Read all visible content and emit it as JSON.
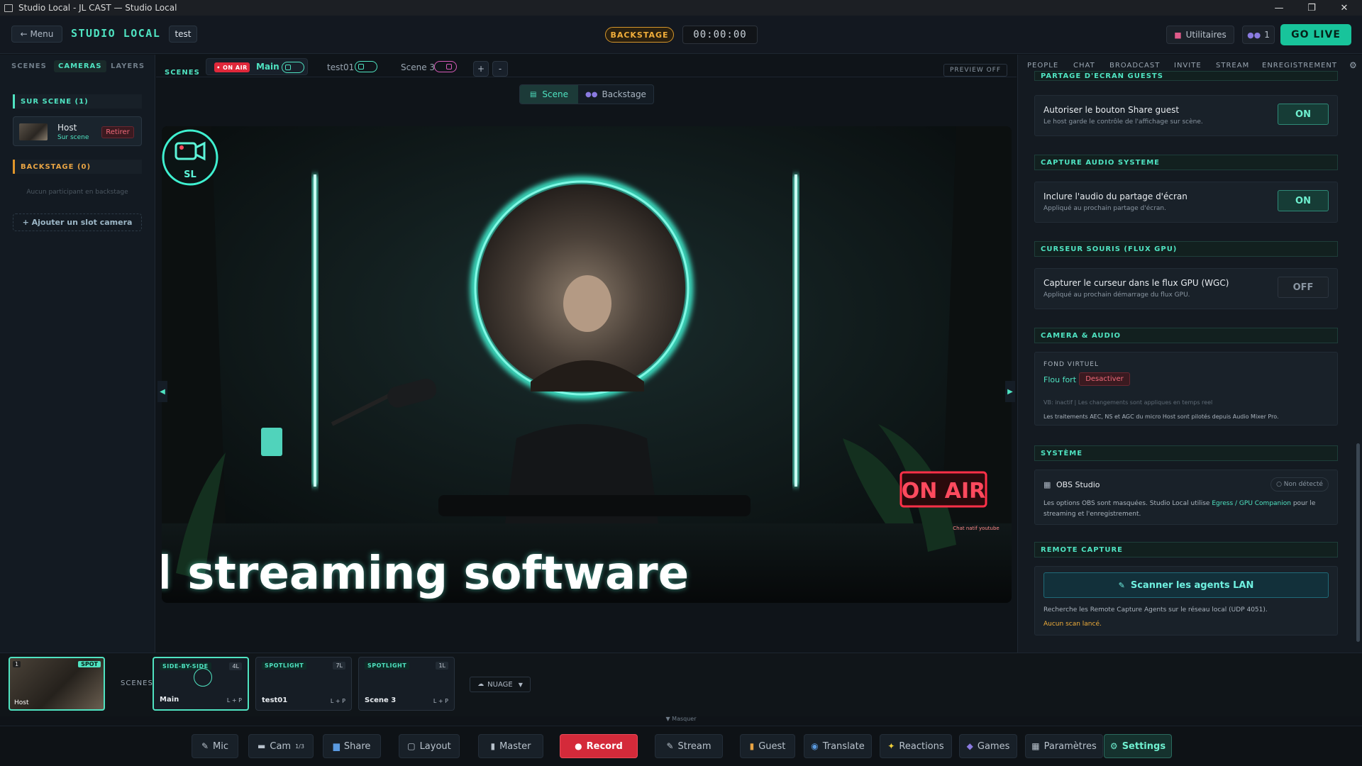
{
  "window": {
    "title": "Studio Local - JL CAST — Studio Local"
  },
  "topbar": {
    "menu_label": "← Menu",
    "brand": "STUDIO LOCAL",
    "project": "test",
    "backstage": "BACKSTAGE",
    "timer": "00:00:00",
    "utilities": "Utilitaires",
    "people_count": "1",
    "go_live": "GO LIVE"
  },
  "left": {
    "tabs": [
      "SCENES",
      "CAMERAS",
      "LAYERS"
    ],
    "on_stage_title": "SUR SCENE (1)",
    "host": {
      "name": "Host",
      "status": "Sur scene",
      "remove": "Retirer"
    },
    "backstage_title": "BACKSTAGE (0)",
    "backstage_empty": "Aucun participant en backstage",
    "add_slot": "+ Ajouter un slot camera"
  },
  "scenes_bar": {
    "label": "SCENES",
    "on_air": "• ON AIR",
    "items": [
      "Main",
      "test01",
      "Scene 3"
    ],
    "add": "+",
    "remove": "-",
    "preview": "PREVIEW OFF"
  },
  "view_toggle": {
    "scene": "Scene",
    "backstage": "Backstage"
  },
  "stage": {
    "logo_text": "SL",
    "on_air_sign": "ON AIR",
    "ticker": "l streaming software",
    "chat_tag": "Chat natif youtube"
  },
  "right": {
    "tabs": [
      "PEOPLE",
      "CHAT",
      "BROADCAST",
      "INVITE",
      "STREAM",
      "ENREGISTREMENT"
    ],
    "sections": {
      "share": "PARTAGE D'ECRAN GUESTS",
      "audio": "CAPTURE AUDIO SYSTEME",
      "cursor": "CURSEUR SOURIS (FLUX GPU)",
      "camera": "CAMERA & AUDIO",
      "system": "SYSTÈME",
      "remote": "REMOTE CAPTURE"
    },
    "share_card": {
      "title": "Autoriser le bouton Share guest",
      "desc": "Le host garde le contrôle de l'affichage sur scène.",
      "state": "ON"
    },
    "audio_card": {
      "title": "Inclure l'audio du partage d'écran",
      "desc": "Appliqué au prochain partage d'écran.",
      "state": "ON"
    },
    "cursor_card": {
      "title": "Capturer le curseur dans le flux GPU (WGC)",
      "desc": "Appliqué au prochain démarrage du flux GPU.",
      "state": "OFF"
    },
    "camera_card": {
      "label": "FOND VIRTUEL",
      "mode": "Flou fort",
      "disable": "Desactiver",
      "note1": "VB: inactif | Les changements sont appliques en temps reel",
      "note2": "Les traitements AEC, NS et AGC du micro Host sont pilotés depuis Audio Mixer Pro."
    },
    "system_card": {
      "title": "OBS Studio",
      "status": "○ Non détecté",
      "desc1": "Les options OBS sont masquées. Studio Local utilise",
      "desc_link": "Egress / GPU Companion",
      "desc2_tail": "pour le",
      "desc3": "streaming et l'enregistrement."
    },
    "remote_card": {
      "scan": "Scanner les agents LAN",
      "desc": "Recherche les Remote Capture Agents sur le réseau local (UDP 4051).",
      "status": "Aucun scan lancé."
    }
  },
  "bottom": {
    "cam": {
      "index": "1",
      "badge": "SPOT",
      "name": "Host"
    },
    "scenes_label": "SCENES",
    "tiles": [
      {
        "layout": "SIDE-BY-SIDE",
        "count": "4L",
        "name": "Main",
        "lp": "L + P"
      },
      {
        "layout": "SPOTLIGHT",
        "count": "7L",
        "name": "test01",
        "lp": "L + P"
      },
      {
        "layout": "SPOTLIGHT",
        "count": "1L",
        "name": "Scene 3",
        "lp": "L + P"
      }
    ],
    "nuage": "NUAGE",
    "masquer": "▼ Masquer"
  },
  "toolbar": {
    "mic": "Mic",
    "cam": "Cam",
    "cam_count": "1/3",
    "share": "Share",
    "layout": "Layout",
    "master": "Master",
    "record": "Record",
    "stream": "Stream",
    "guest": "Guest",
    "translate": "Translate",
    "reactions": "Reactions",
    "games": "Games",
    "params": "Paramètres",
    "settings": "Settings"
  },
  "colors": {
    "accent": "#4fe3c1",
    "record": "#d42a3a",
    "warning": "#f1ae3a",
    "danger": "#f06a7a"
  }
}
